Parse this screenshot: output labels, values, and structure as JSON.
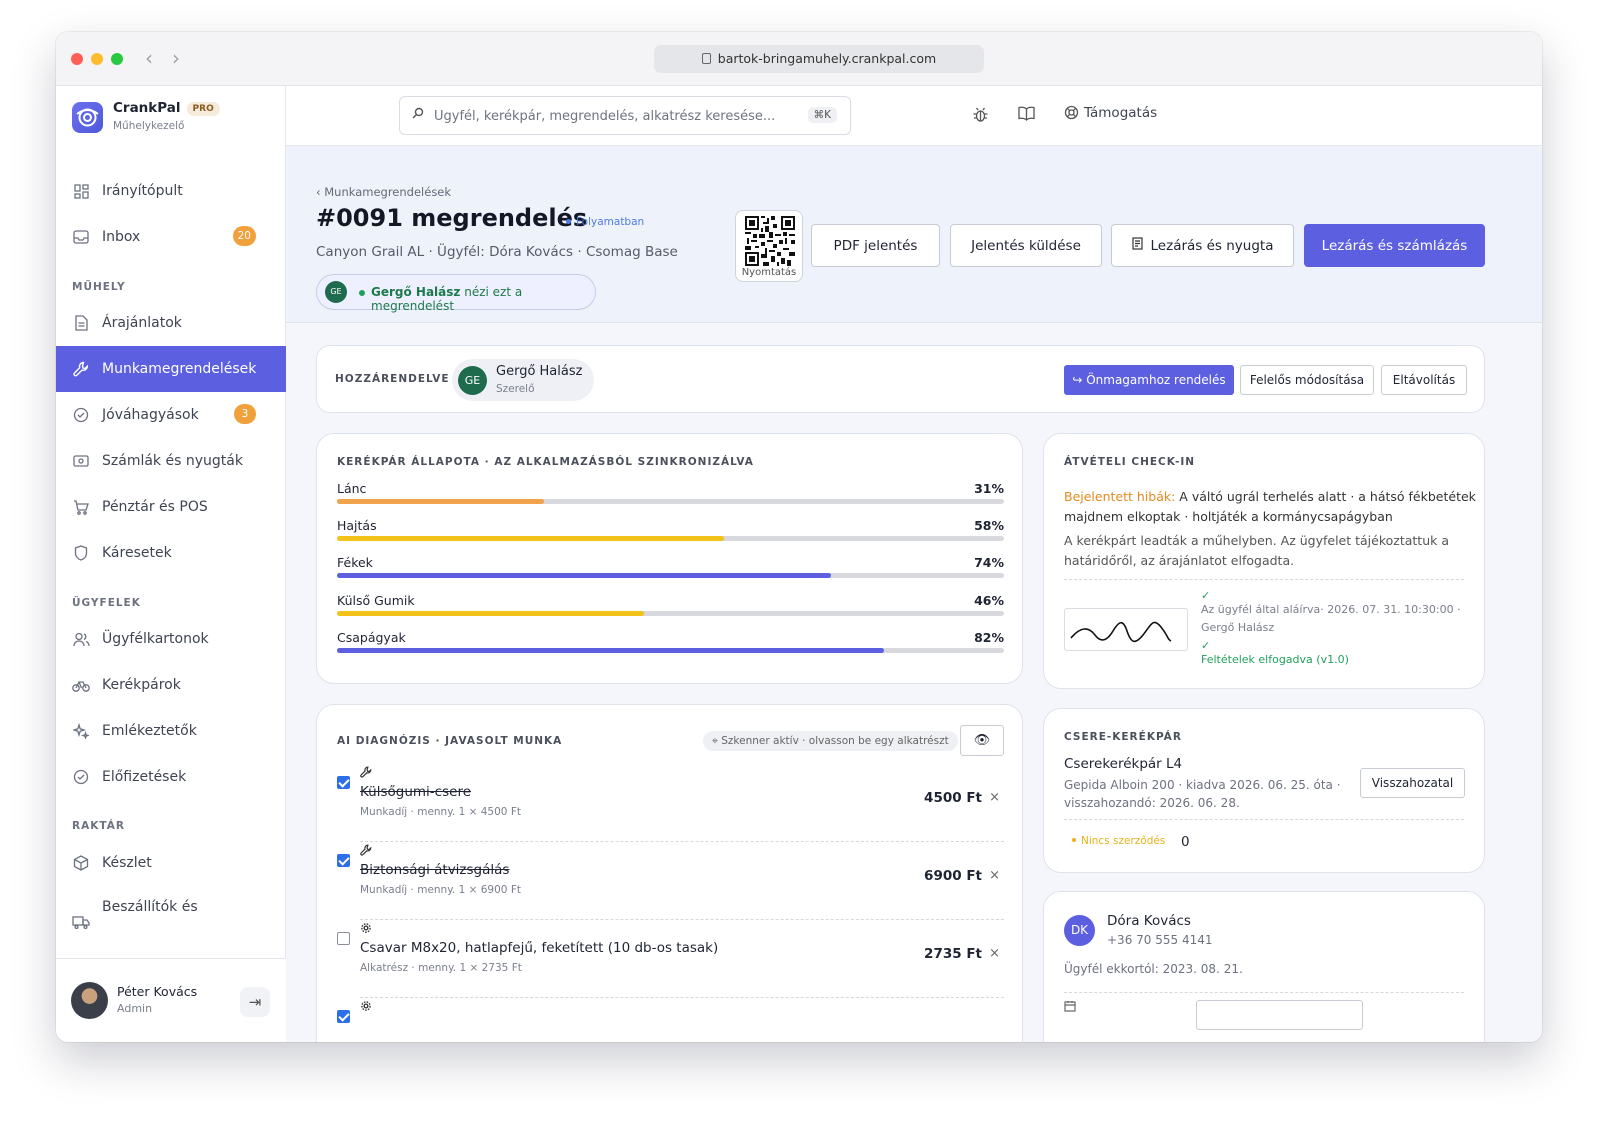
{
  "browser": {
    "url": "bartok-bringamuhely.crankpal.com"
  },
  "brand": {
    "name": "CrankPal",
    "badge": "PRO",
    "subtitle": "Műhelykezelő"
  },
  "sidebar": {
    "items": [
      {
        "label": "Irányítópult",
        "icon": "dashboard-icon"
      },
      {
        "label": "Inbox",
        "icon": "inbox-icon",
        "badge": "20"
      },
      {
        "label": "Árajánlatok",
        "icon": "document-icon"
      },
      {
        "label": "Munkamegrendelések",
        "icon": "wrench-icon",
        "active": true
      },
      {
        "label": "Jóváhagyások",
        "icon": "check-circle-icon",
        "badge": "3"
      },
      {
        "label": "Számlák és nyugták",
        "icon": "invoice-icon"
      },
      {
        "label": "Pénztár és POS",
        "icon": "cart-icon"
      },
      {
        "label": "Káresetek",
        "icon": "shield-icon"
      },
      {
        "label": "Ügyfélkartonok",
        "icon": "users-icon"
      },
      {
        "label": "Kerékpárok",
        "icon": "bike-icon"
      },
      {
        "label": "Emlékeztetők",
        "icon": "sparkle-icon"
      },
      {
        "label": "Előfizetések",
        "icon": "check-circle-icon"
      },
      {
        "label": "Készlet",
        "icon": "box-icon"
      },
      {
        "label": "Beszállítók és",
        "icon": "truck-icon"
      }
    ],
    "sections": {
      "workshop": "MŰHELY",
      "customers": "ÜGYFELEK",
      "stock": "RAKTÁR"
    },
    "user": {
      "name": "Péter Kovács",
      "role": "Admin"
    }
  },
  "topbar": {
    "search_placeholder": "Ügyfél, kerékpár, megrendelés, alkatrész keresése...",
    "shortcut": "⌘K",
    "support": "Támogatás"
  },
  "header": {
    "breadcrumb": "‹ Munkamegrendelések",
    "title": "#0091 megrendelés",
    "status": "Folyamatban",
    "subtitle": "Canyon Grail AL · Ügyfél: Dóra Kovács · Csomag Base",
    "viewer_initials": "GE",
    "viewer_name": "Gergő Halász",
    "viewer_text": " nézi ezt a megrendelést",
    "qr_label": "Nyomtatás",
    "buttons": {
      "pdf": "PDF jelentés",
      "send": "Jelentés küldése",
      "close_receipt": "Lezárás és nyugta",
      "close_invoice": "Lezárás és számlázás"
    }
  },
  "assigned": {
    "label": "HOZZÁRENDELVE",
    "initials": "GE",
    "name": "Gergő Halász",
    "role": "Szerelő",
    "btn_self": "↪ Önmagamhoz rendelés",
    "btn_change": "Felelős módosítása",
    "btn_remove": "Eltávolítás"
  },
  "health": {
    "title": "KERÉKPÁR ÁLLAPOTA · AZ ALKALMAZÁSBÓL SZINKRONIZÁLVA",
    "rows": [
      {
        "name": "Lánc",
        "value": 31,
        "label": "31%",
        "color": "#f0a24c"
      },
      {
        "name": "Hajtás",
        "value": 58,
        "label": "58%",
        "color": "#f2c21b"
      },
      {
        "name": "Fékek",
        "value": 74,
        "label": "74%",
        "color": "#5b5fe0"
      },
      {
        "name": "Külső Gumik",
        "value": 46,
        "label": "46%",
        "color": "#f2c21b"
      },
      {
        "name": "Csapágyak",
        "value": 82,
        "label": "82%",
        "color": "#5b5fe0"
      }
    ]
  },
  "checkin": {
    "title": "ÁTVÉTELI CHECK-IN",
    "issues_label": "Bejelentett hibák:",
    "issues_line1": " A váltó ugrál terhelés alatt · a hátsó fékbetétek",
    "issues_line2": "majdnem elkoptak · holtjáték a kormánycsapágyban",
    "note_line1": "A kerékpárt leadták a műhelyben. Az ügyfelet tájékoztattuk a",
    "note_line2": "határidőről, az árajánlatot elfogadta.",
    "signed_line1": "Az ügyfél által aláírva· 2026. 07. 31. 10:30:00 ·",
    "signed_line2": "Gergő Halász",
    "terms": "Feltételek elfogadva (v1.0)"
  },
  "diagnosis": {
    "title": "AI DIAGNÓZIS · JAVASOLT MUNKA",
    "scanner": "⌖ Szkenner aktív · olvasson be egy alkatrészt",
    "items": [
      {
        "checked": true,
        "type_icon": "wrench-icon",
        "name": "Külsőgumi-csere",
        "meta": "Munkadíj · menny. 1 × 4500 Ft",
        "price": "4500 Ft",
        "done": true
      },
      {
        "checked": true,
        "type_icon": "wrench-icon",
        "name": "Biztonsági átvizsgálás",
        "meta": "Munkadíj · menny. 1 × 6900 Ft",
        "price": "6900 Ft",
        "done": true
      },
      {
        "checked": false,
        "type_icon": "gear-icon",
        "name": "Csavar M8x20, hatlapfejű, feketített (10 db-os tasak)",
        "meta": "Alkatrész · menny. 1 × 2735 Ft",
        "price": "2735 Ft",
        "done": false
      },
      {
        "checked": true,
        "type_icon": "gear-icon",
        "name": "",
        "meta": "",
        "price": "",
        "done": false
      }
    ]
  },
  "loaner": {
    "title": "CSERE-KERÉKPÁR",
    "name": "Cserekerékpár L4",
    "line1": "Gepida Alboin 200 · kiadva 2026. 06. 25. óta ·",
    "line2": "visszahozandó: 2026. 06. 28.",
    "return_btn": "Visszahozatal",
    "contract": "Nincs szerződés",
    "count": "0"
  },
  "customer": {
    "initials": "DK",
    "name": "Dóra Kovács",
    "phone": "+36 70 555 4141",
    "since": "Ügyfél ekkortól: 2023. 08. 21."
  }
}
